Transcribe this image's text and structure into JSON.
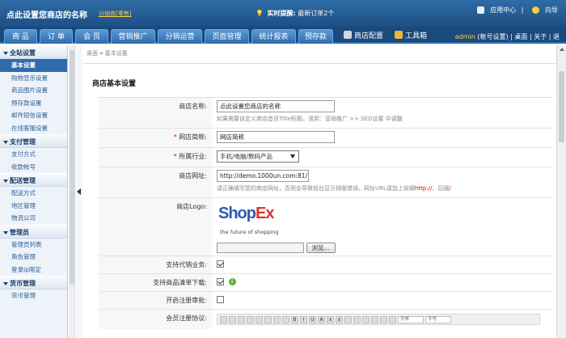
{
  "header": {
    "shop_title": "点此设置您商店的名称",
    "shop_subtitle": "分销商[零售]",
    "notice_label": "实时提醒:",
    "notice_text": "最新订单2个",
    "app_center": "应用中心",
    "guide": "向导"
  },
  "nav": {
    "tabs": [
      "商 品",
      "订 单",
      "会 员",
      "营销推广",
      "分销运营",
      "页面管理",
      "统计报表",
      "预存款"
    ],
    "tools": [
      "商店配置",
      "工具箱"
    ],
    "account": {
      "user": "admin",
      "settings": "(帐号设置)",
      "desktop": "桌面",
      "about": "关于",
      "logout": "退"
    }
  },
  "sidebar": {
    "sections": [
      {
        "title": "全站设置",
        "items": [
          "基本设置",
          "购物显示设置",
          "商品图片设置",
          "预存款设置",
          "邮件短信设置",
          "在线客服设置"
        ]
      },
      {
        "title": "支付管理",
        "items": [
          "支付方式",
          "收款帐号"
        ]
      },
      {
        "title": "配送管理",
        "items": [
          "配送方式",
          "地区管理",
          "物流公司"
        ]
      },
      {
        "title": "管理员",
        "items": [
          "管理员列表",
          "角色管理",
          "登录ip限定"
        ]
      },
      {
        "title": "货币管理",
        "items": [
          "货币管理"
        ]
      }
    ],
    "active_item": "基本设置"
  },
  "breadcrumb": {
    "home": "桌面",
    "separator": "»",
    "current": "基本设置"
  },
  "main": {
    "panel_title": "商店基本设置",
    "fields": {
      "shop_name": {
        "label": "商店名称:",
        "value": "点此设置您商店的名称",
        "hint": "如果需要自定义商店首页Title标题，请到：营销推广 >> SEO设置 中调整"
      },
      "site_short": {
        "label": "网店简称:",
        "value": "网店简称"
      },
      "industry": {
        "label": "所属行业:",
        "value": "手机/电脑/数码产品"
      },
      "shop_url": {
        "label": "商店网址:",
        "value": "http://demo.1000un.com:81/",
        "hint_before": "请正确填写您的商店网址，否则会导致前台显示排版错误。网址URL请加上前缀",
        "hint_red": "http://",
        "hint_after": "，后缀",
        "hint_red2": "/"
      },
      "logo": {
        "label": "商店Logo:",
        "logo_text_a": "Shop",
        "logo_text_b": "Ex",
        "logo_tagline": "the future of shopping",
        "browse": "浏览..."
      },
      "distribution": {
        "label": "支持代销业务:",
        "checked": true
      },
      "list_download": {
        "label": "支持商品清单下载:",
        "checked": true,
        "info": "i"
      },
      "reg_review": {
        "label": "开启注册审批:",
        "checked": false
      },
      "member_agreement": {
        "label": "会员注册协议:",
        "toolbar_buttons": [
          "B",
          "I",
          "U",
          "A",
          "x",
          "x",
          "≡",
          "≡",
          "≡",
          "≡",
          "≡",
          "≡",
          "¶",
          "◊",
          "☺",
          "⌘"
        ],
        "font_dropdown": "字体",
        "size_dropdown": "字号"
      }
    }
  }
}
